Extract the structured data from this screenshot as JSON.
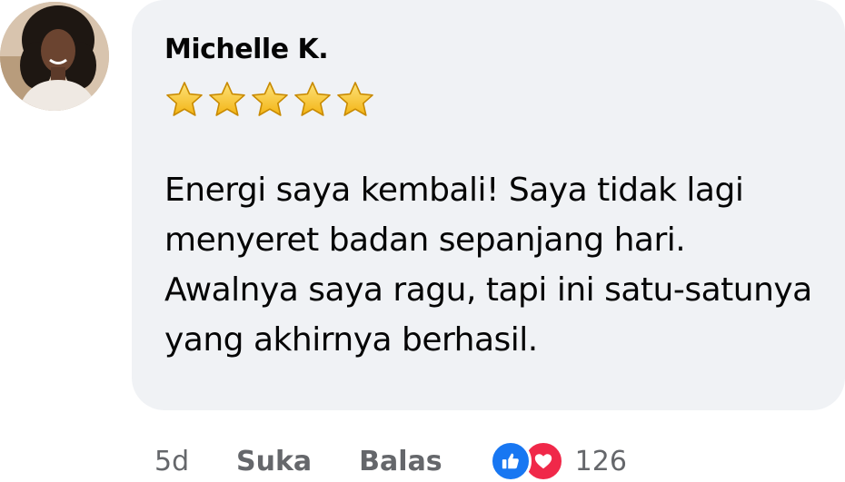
{
  "comment": {
    "author": "Michelle K.",
    "rating": 5,
    "body": "Energi saya kembali! Saya tidak lagi menyeret badan sepanjang hari. Awalnya saya ragu, tapi ini satu-satunya yang akhirnya berhasil.",
    "timestamp": "5d",
    "like_label": "Suka",
    "reply_label": "Balas",
    "reaction_count": "126",
    "reaction_icons": [
      "like-icon",
      "love-icon"
    ]
  },
  "colors": {
    "bubble": "#f0f2f5",
    "text": "#050505",
    "meta": "#65676b",
    "like": "#1877f2",
    "love": "#f02849",
    "star": "#f7c51e"
  }
}
